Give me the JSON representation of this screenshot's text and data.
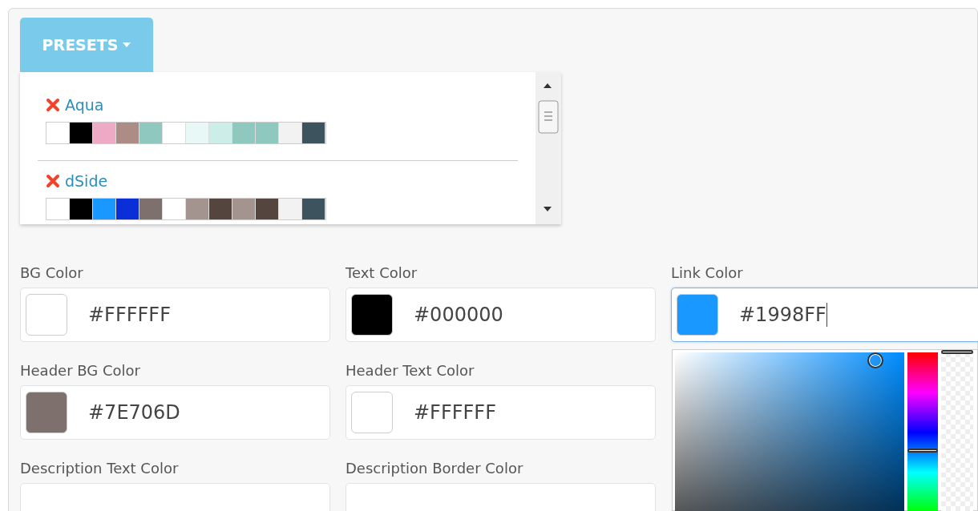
{
  "presets_button": {
    "label": "PRESETS"
  },
  "presets": [
    {
      "name": "Aqua",
      "swatches": [
        {
          "color": "#ffffff"
        },
        {
          "color": "#000000"
        },
        {
          "color": "#eeaac5"
        },
        {
          "color": "#ad8c85"
        },
        {
          "color": "#8ec8bf"
        },
        {
          "color": "#ffffff"
        },
        {
          "color": "#e8f8f7"
        },
        {
          "color": "#cdeee8"
        },
        {
          "color": "#8ec8bf"
        },
        {
          "color": "#8ec8bf"
        },
        {
          "color": "#f2f2f2"
        },
        {
          "color": "#3d535d"
        }
      ]
    },
    {
      "name": "dSide",
      "swatches": [
        {
          "color": "#ffffff"
        },
        {
          "color": "#000000"
        },
        {
          "color": "#1998ff"
        },
        {
          "color": "#0a2fd8"
        },
        {
          "color": "#7e706d"
        },
        {
          "color": "#ffffff"
        },
        {
          "color": "#a39490"
        },
        {
          "color": "#54453f"
        },
        {
          "color": "#a39490"
        },
        {
          "color": "#54453f"
        },
        {
          "color": "#f2f2f2"
        },
        {
          "color": "#3d535d"
        }
      ]
    }
  ],
  "field_rows": [
    [
      {
        "label": "BG Color",
        "value": "#FFFFFF",
        "color": "#ffffff",
        "focused": false
      },
      {
        "label": "Text Color",
        "value": "#000000",
        "color": "#000000",
        "focused": false
      },
      {
        "label": "Link Color",
        "value": "#1998FF",
        "color": "#1998ff",
        "focused": true
      }
    ],
    [
      {
        "label": "Header BG Color",
        "value": "#7E706D",
        "color": "#7e706d",
        "focused": false
      },
      {
        "label": "Header Text Color",
        "value": "#FFFFFF",
        "color": "#ffffff",
        "focused": false
      }
    ],
    [
      {
        "label": "Description Text Color",
        "focused": false
      },
      {
        "label": "Description Border Color",
        "focused": false
      }
    ]
  ],
  "picker": {
    "hue_slider": {
      "level": 0.38
    },
    "alpha_slider": {
      "level": 1
    }
  }
}
